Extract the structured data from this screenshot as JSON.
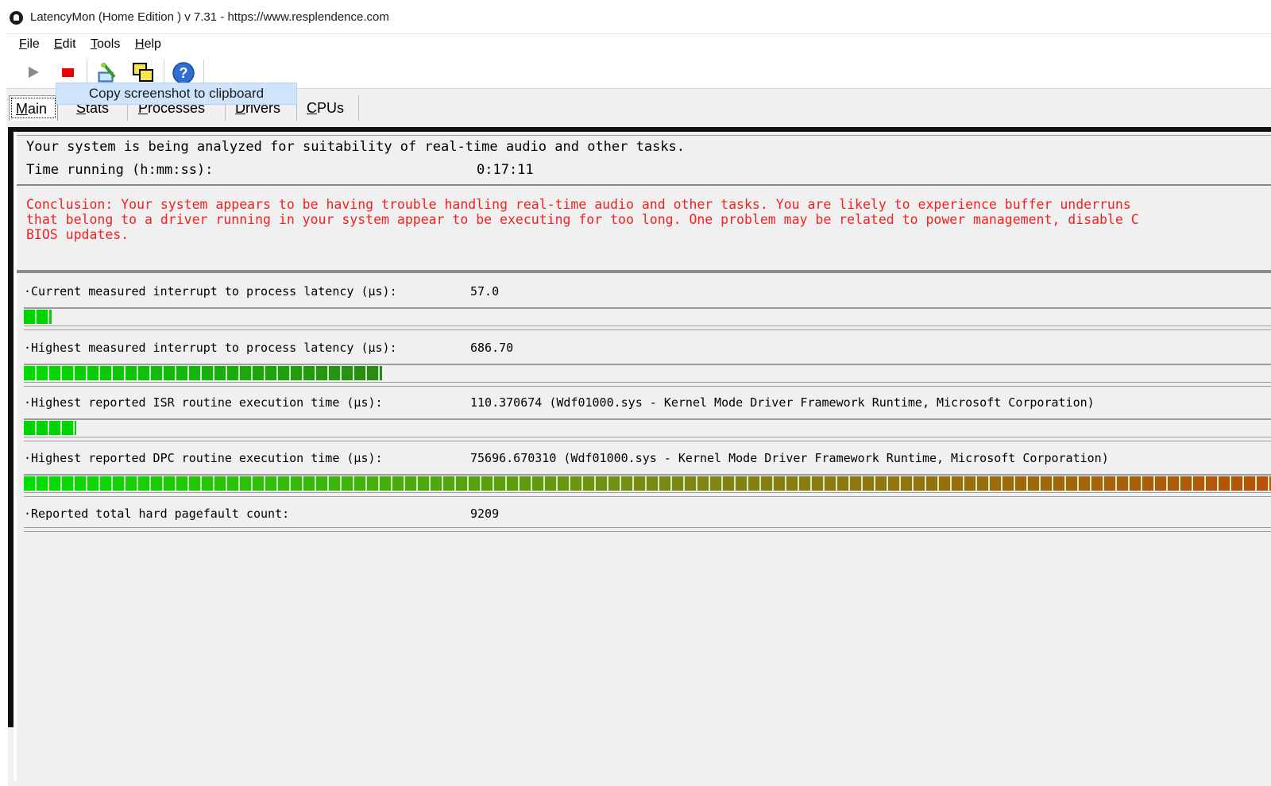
{
  "window": {
    "title": "LatencyMon  (Home Edition )  v 7.31 - https://www.resplendence.com",
    "app_icon": "latencymon-icon"
  },
  "menu": [
    "File",
    "Edit",
    "Tools",
    "Help"
  ],
  "toolbar": {
    "buttons": [
      {
        "name": "start-monitor-button",
        "icon": "play-icon"
      },
      {
        "name": "stop-monitor-button",
        "icon": "stop-icon"
      },
      {
        "name": "report-button",
        "icon": "report-icon"
      },
      {
        "name": "copy-screenshot-button",
        "icon": "copy-screenshot-icon"
      },
      {
        "name": "help-button",
        "icon": "help-icon"
      }
    ],
    "tooltip": "Copy screenshot to clipboard"
  },
  "tabs": [
    "Main",
    "Stats",
    "Processes",
    "Drivers",
    "CPUs"
  ],
  "active_tab": "Main",
  "status": {
    "line1": "Your system is being analyzed for suitability of real-time audio and other tasks.",
    "time_label": "Time running (h:mm:ss):",
    "time_value": "0:17:11"
  },
  "conclusion": {
    "line1": "Conclusion: Your system appears to be having trouble handling real-time audio and other tasks. You are likely to experience buffer underruns",
    "line2": "that belong to a driver running in your system appear to be executing for too long. One problem may be related to power management, disable C",
    "line3": "BIOS updates.",
    "color": "#f51f1f"
  },
  "metrics": [
    {
      "label": "·Current measured interrupt to process latency (µs):",
      "value": "57.0",
      "bar_fraction": 0.022,
      "bar_colors": [
        "#00d400",
        "#00d400"
      ]
    },
    {
      "label": "·Highest measured interrupt to process latency (µs):",
      "value": "686.70",
      "bar_fraction": 0.287,
      "bar_colors": [
        "#00dd00",
        "#2a8a10"
      ]
    },
    {
      "label": "·Highest reported ISR routine execution time (µs):",
      "value": "110.370674   (Wdf01000.sys - Kernel Mode Driver Framework Runtime, Microsoft Corporation)",
      "bar_fraction": 0.042,
      "bar_colors": [
        "#00d400",
        "#00d400"
      ]
    },
    {
      "label": "·Highest reported DPC routine execution time (µs):",
      "value": "75696.670310   (Wdf01000.sys - Kernel Mode Driver Framework Runtime, Microsoft Corporation)",
      "bar_fraction": 1.0,
      "bar_colors": [
        "#00e000",
        "#7a8a10",
        "#b85208"
      ]
    },
    {
      "label": "·Reported total hard pagefault count:",
      "value": "9209"
    }
  ]
}
